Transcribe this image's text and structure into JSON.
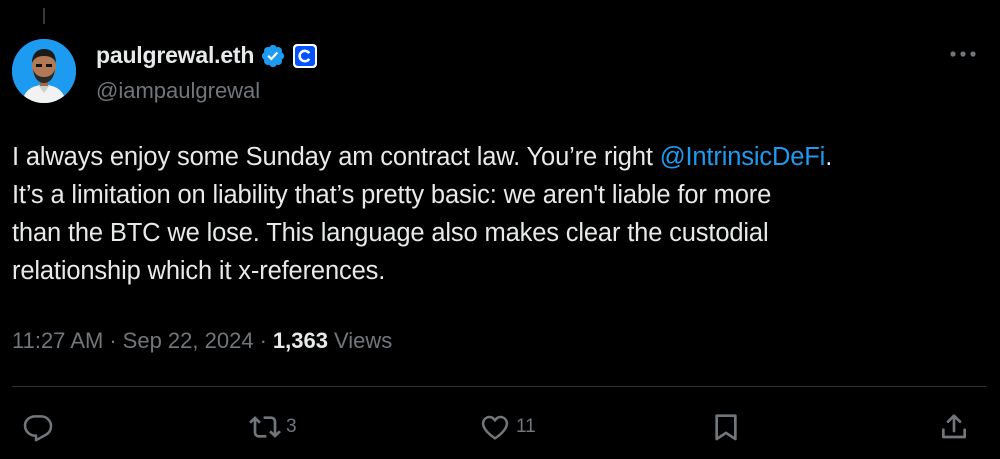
{
  "author": {
    "display_name": "paulgrewal.eth",
    "handle": "@iampaulgrewal"
  },
  "icons": {
    "verified": "verified-badge-icon",
    "affiliate": "coinbase-affiliate-icon",
    "more": "more-horizontal-icon",
    "reply": "reply-icon",
    "retweet": "retweet-icon",
    "like": "heart-icon",
    "bookmark": "bookmark-icon",
    "share": "share-icon"
  },
  "tweet": {
    "line1_before": "I always enjoy some Sunday am contract law. You’re right ",
    "mention": "@IntrinsicDeFi",
    "line1_after": ".",
    "line2": "It’s a limitation on liability that’s pretty basic: we aren't liable for more",
    "line3": "than the BTC we lose. This language also makes clear the custodial",
    "line4": "relationship which it x-references."
  },
  "meta": {
    "time": "11:27 AM",
    "separator": "·",
    "date": "Sep 22, 2024",
    "views_count": "1,363",
    "views_label": "Views"
  },
  "actions": {
    "retweet_count": "3",
    "like_count": "11"
  },
  "colors": {
    "background": "#000000",
    "text": "#e7e9ea",
    "secondary": "#71767b",
    "accent": "#1d9bf0",
    "divider": "#2f3336"
  }
}
